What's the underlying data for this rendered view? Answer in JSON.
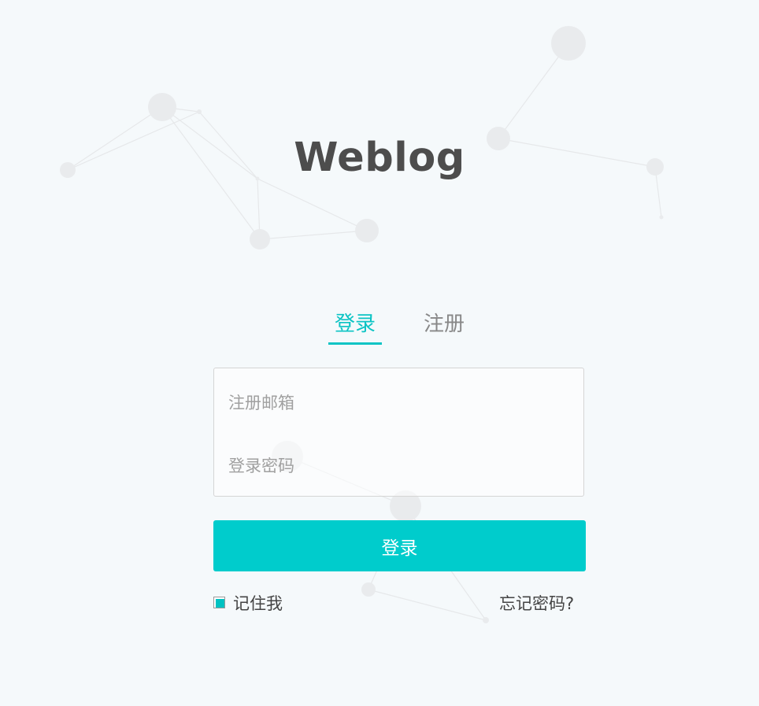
{
  "header": {
    "title": "Weblog"
  },
  "tabs": [
    {
      "label": "登录",
      "active": true
    },
    {
      "label": "注册",
      "active": false
    }
  ],
  "form": {
    "email": {
      "placeholder": "注册邮箱",
      "value": ""
    },
    "password": {
      "placeholder": "登录密码",
      "value": ""
    },
    "submit_label": "登录",
    "remember_label": "记住我",
    "remember_checked": true,
    "forgot_label": "忘记密码?"
  },
  "colors": {
    "accent": "#00cccc",
    "background": "#f5f9fb",
    "title": "#4d4d4d"
  }
}
